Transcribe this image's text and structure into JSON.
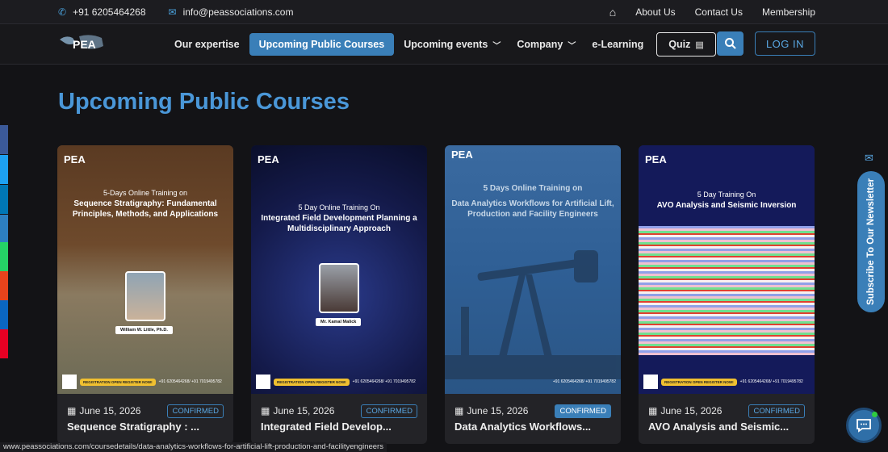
{
  "topbar": {
    "phone": "+91 6205464268",
    "email": "info@peassociations.com",
    "links": [
      "About Us",
      "Contact Us",
      "Membership"
    ]
  },
  "nav": {
    "logo_text": "PEA",
    "items": [
      {
        "label": "Our expertise"
      },
      {
        "label": "Upcoming Public Courses"
      },
      {
        "label": "Upcoming events"
      },
      {
        "label": "Company"
      },
      {
        "label": "e-Learning"
      },
      {
        "label": "Quiz"
      }
    ],
    "login_label": "LOG IN"
  },
  "page_title": "Upcoming Public Courses",
  "cards": [
    {
      "date": "June 15, 2026",
      "status": "CONFIRMED",
      "title": "Sequence Stratigraphy : ...",
      "poster_line1": "5-Days Online Training on",
      "poster_line2": "Sequence Stratigraphy: Fundamental Principles, Methods, and Applications",
      "presenter": "William W. Little, Ph.D."
    },
    {
      "date": "June 15, 2026",
      "status": "CONFIRMED",
      "title": "Integrated Field Develop...",
      "poster_line1": "5 Day Online Training On",
      "poster_line2": "Integrated Field Development Planning a Multidisciplinary Approach",
      "presenter": "Mr. Kamal Malick"
    },
    {
      "date": "June 15, 2026",
      "status": "CONFIRMED",
      "title": "Data Analytics Workflows...",
      "poster_line1": "5 Days Online Training on",
      "poster_line2": "Data Analytics Workflows for Artificial Lift, Production and Facility Engineers",
      "presenter": ""
    },
    {
      "date": "June 15, 2026",
      "status": "CONFIRMED",
      "title": "AVO Analysis and Seismic...",
      "poster_line1": "5 Day Training On",
      "poster_line2": "AVO Analysis and Seismic Inversion",
      "presenter": ""
    }
  ],
  "poster_footer": {
    "register": "REGISTRATION OPEN REGISTER NOW!",
    "contact": "+91 6205464268/ +91 7019495782",
    "site": "www.peassociations.com"
  },
  "newsletter_label": "Subscribe To Our Newsletter",
  "status_url": "www.peassociations.com/coursedetails/data-analytics-workflows-for-artificial-lift-production-and-facilityengineers",
  "colors": {
    "accent": "#3a7fb8",
    "title": "#4a97d8",
    "background": "#131316",
    "card": "#232327"
  }
}
